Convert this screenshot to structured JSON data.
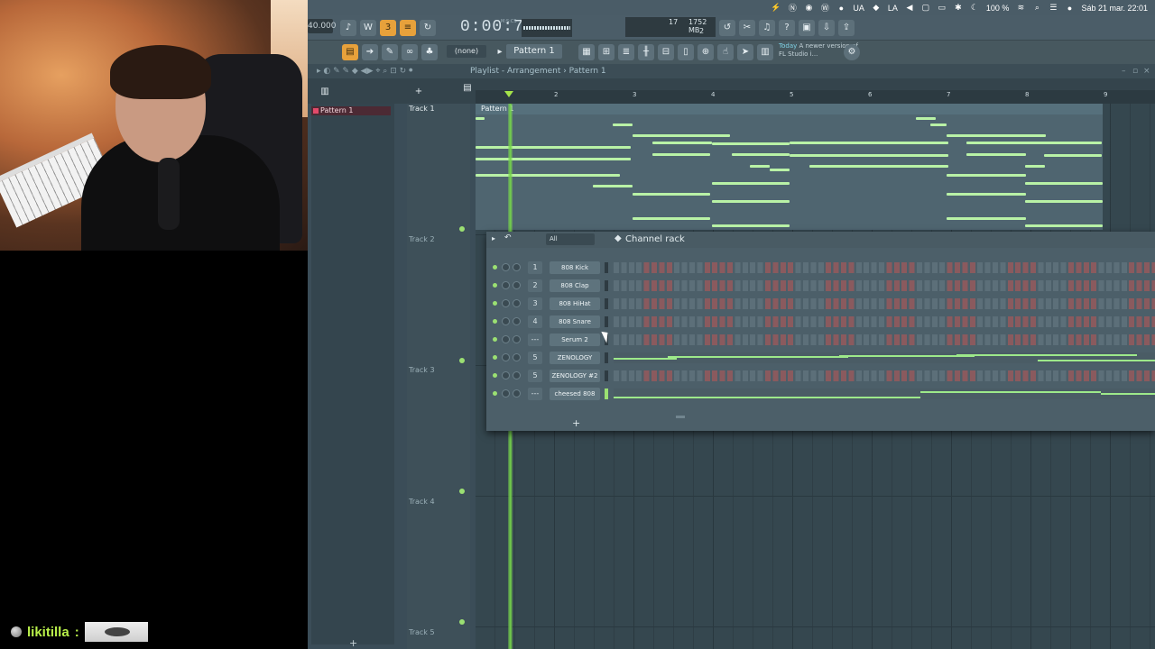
{
  "colors": {
    "accent_green": "#9be072",
    "note_green": "#b9f2a6",
    "playhead": "#74d44a",
    "chat_user": "#b9f04a",
    "toolbar_orange": "#e7a13b",
    "pattern_red": "#e24a6a"
  },
  "chat": {
    "username": "likitilla",
    "separator": ":"
  },
  "mac_menu_bar": {
    "badge_ua": "UA",
    "badge_la": "LA",
    "battery": "100 %",
    "datetime": "Sáb 21 mar.  22:01",
    "icons": [
      "bolt-icon",
      "n-icon",
      "record-icon",
      "whatsapp-icon",
      "bolt-icon",
      "spotify-icon",
      "audio-icon",
      "wifi-icon",
      "search-icon",
      "control-center-icon",
      "siri-icon"
    ]
  },
  "toolbar": {
    "tempo": "40.000",
    "time": "0:00:71",
    "time_unit": "M:S:CS",
    "cpu_value": "17",
    "memory": "1752 MB",
    "polyphony": "2",
    "pattern_select": "(none)",
    "pattern_name": "Pattern 1",
    "news_label": "Today",
    "news_text": "A newer version of FL Studio i..."
  },
  "playlist": {
    "title": "Playlist - Arrangement › Pattern 1",
    "pattern_list": [
      "Pattern 1"
    ],
    "tracks": [
      "Track 1",
      "Track 2",
      "Track 3",
      "Track 4",
      "Track 5"
    ],
    "ruler_numbers": [
      "2",
      "3",
      "4",
      "5",
      "6",
      "7",
      "8",
      "9"
    ],
    "clip_label": "Pattern 1"
  },
  "channel_rack": {
    "title": "Channel rack",
    "filter": "All",
    "channels": [
      {
        "num": "1",
        "name": "808 Kick",
        "type": "steps"
      },
      {
        "num": "2",
        "name": "808 Clap",
        "type": "steps"
      },
      {
        "num": "3",
        "name": "808 HiHat",
        "type": "steps"
      },
      {
        "num": "4",
        "name": "808 Snare",
        "type": "steps"
      },
      {
        "num": "---",
        "name": "Serum 2",
        "type": "steps"
      },
      {
        "num": "5",
        "name": "ZENOLOGY",
        "type": "piano"
      },
      {
        "num": "5",
        "name": "ZENOLOGY #2",
        "type": "steps"
      },
      {
        "num": "---",
        "name": "cheesed 808",
        "type": "piano"
      }
    ]
  }
}
